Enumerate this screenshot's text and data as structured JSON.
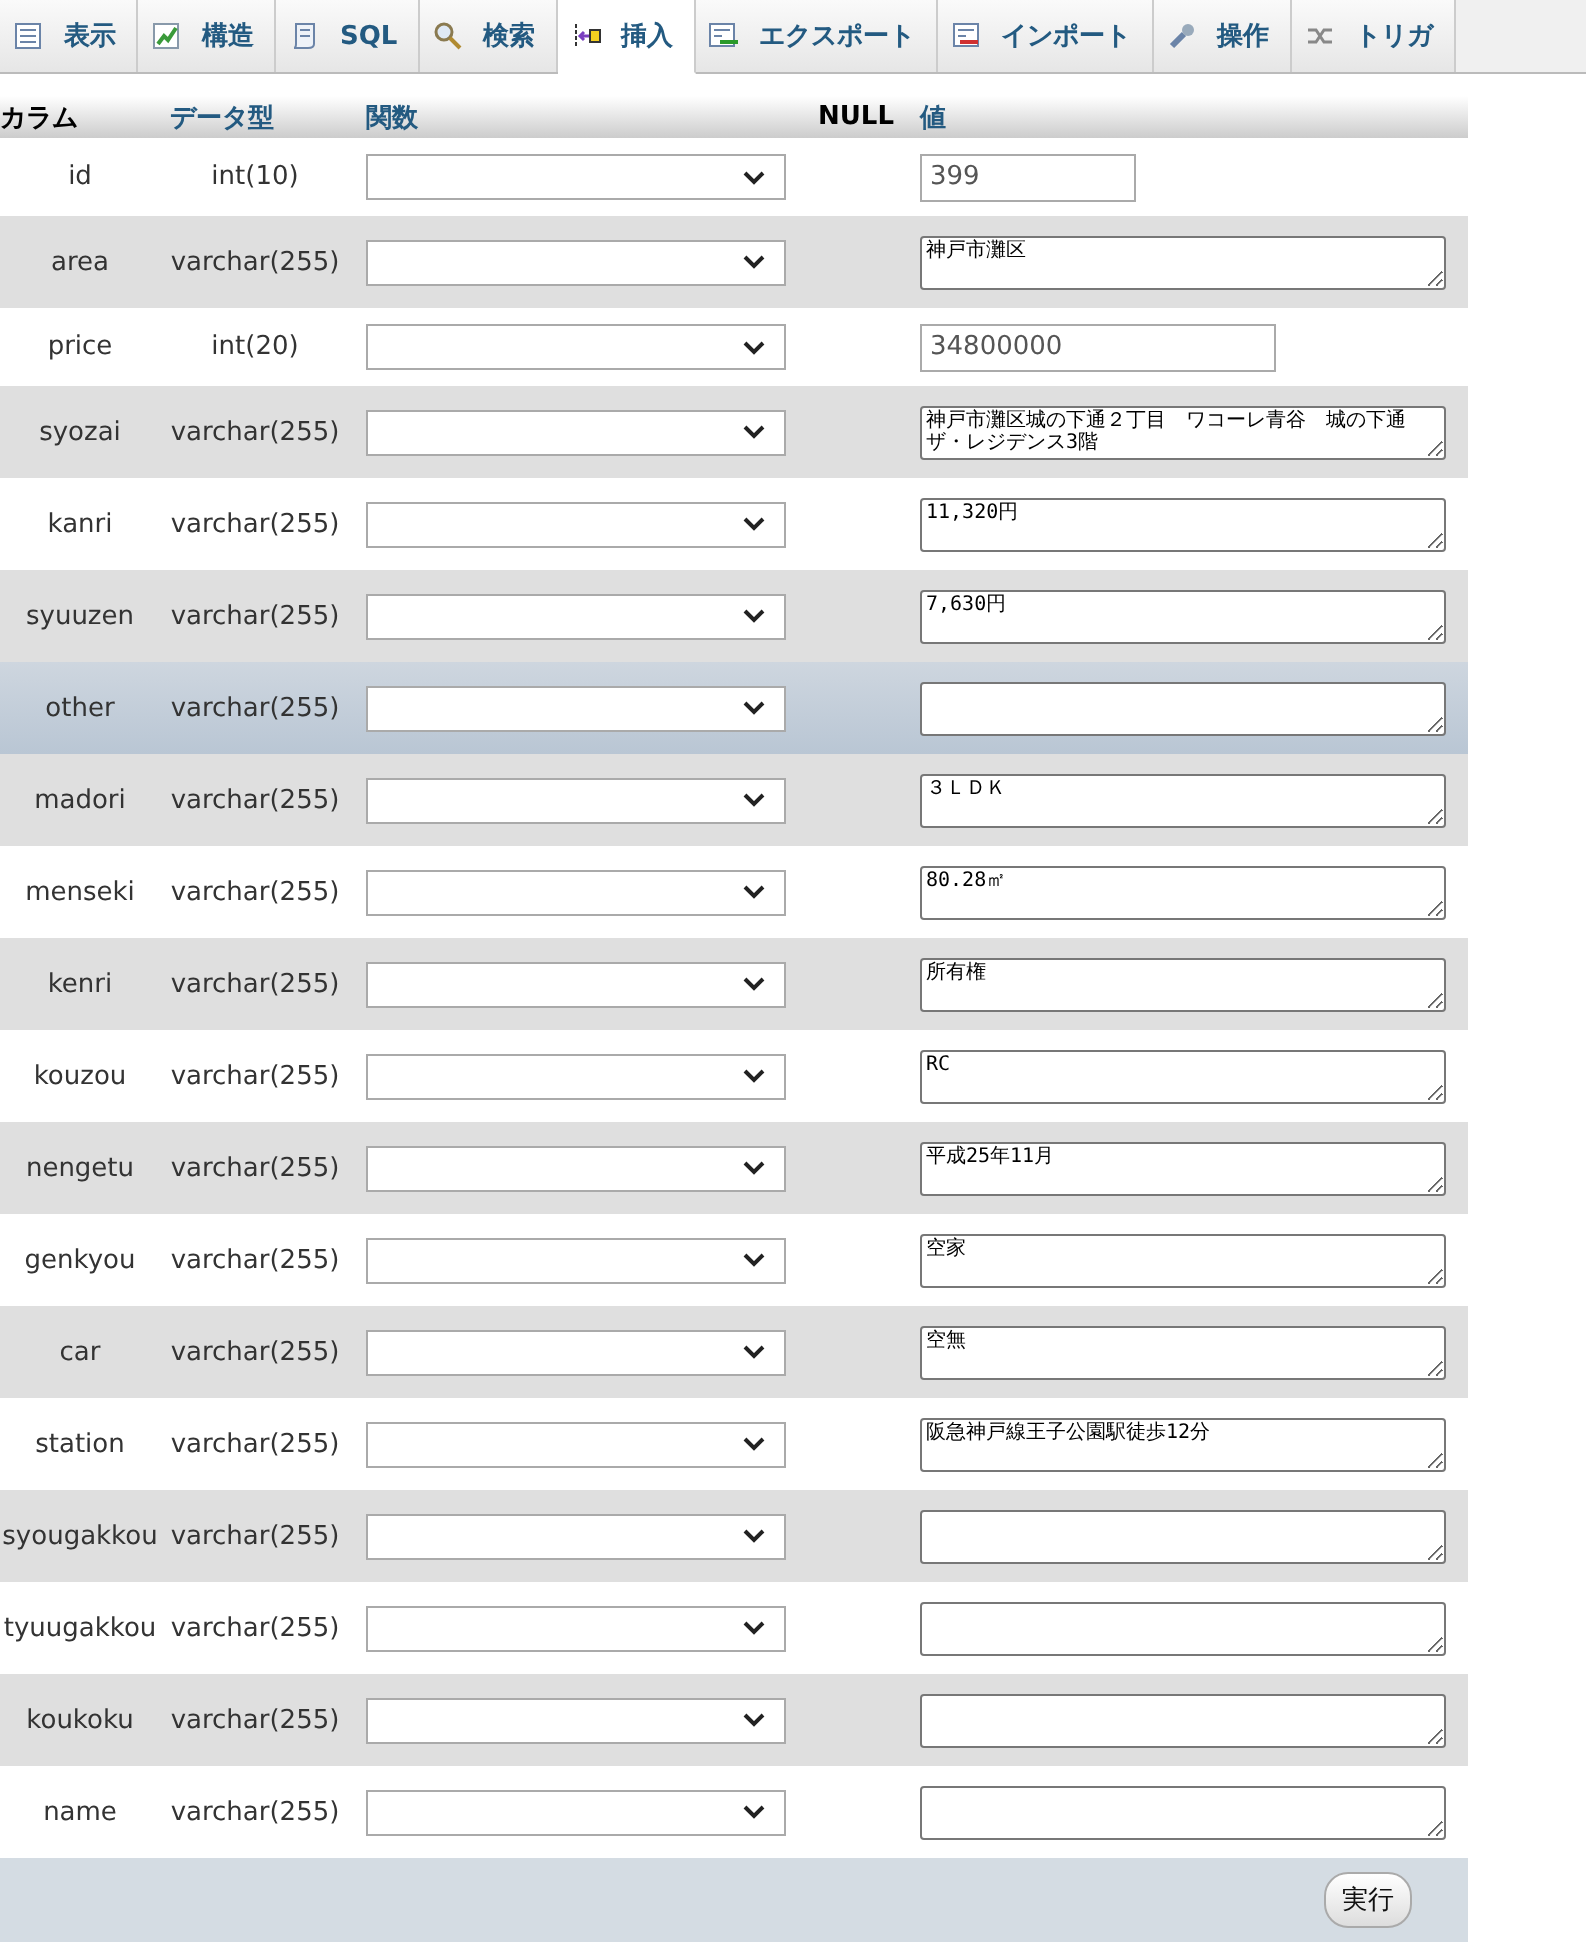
{
  "tabs": [
    {
      "label": "表示",
      "kind": "browse",
      "selected": false
    },
    {
      "label": "構造",
      "kind": "structure",
      "selected": false
    },
    {
      "label": "SQL",
      "kind": "sql",
      "selected": false
    },
    {
      "label": "検索",
      "kind": "search",
      "selected": false
    },
    {
      "label": "挿入",
      "kind": "insert",
      "selected": true
    },
    {
      "label": "エクスポート",
      "kind": "export",
      "selected": false
    },
    {
      "label": "インポート",
      "kind": "import",
      "selected": false
    },
    {
      "label": "操作",
      "kind": "operations",
      "selected": false
    },
    {
      "label": "トリガ",
      "kind": "triggers",
      "selected": false
    }
  ],
  "table": {
    "columns": [
      "カラム",
      "データ型",
      "関数",
      "NULL",
      "値"
    ],
    "rows": [
      {
        "column": "id",
        "type": "int(10)",
        "kind": "input",
        "value": "399",
        "highlighted": false
      },
      {
        "column": "area",
        "type": "varchar(255)",
        "kind": "textarea",
        "value": "神戸市灘区",
        "highlighted": false
      },
      {
        "column": "price",
        "type": "int(20)",
        "kind": "input",
        "value": "34800000",
        "highlighted": false
      },
      {
        "column": "syozai",
        "type": "varchar(255)",
        "kind": "textarea",
        "value": "神戸市灘区城の下通２丁目　ワコーレ青谷　城の下通ザ・レジデンス3階",
        "highlighted": false
      },
      {
        "column": "kanri",
        "type": "varchar(255)",
        "kind": "textarea",
        "value": "11,320円",
        "highlighted": false
      },
      {
        "column": "syuuzen",
        "type": "varchar(255)",
        "kind": "textarea",
        "value": "7,630円",
        "highlighted": false
      },
      {
        "column": "other",
        "type": "varchar(255)",
        "kind": "textarea",
        "value": "",
        "highlighted": true
      },
      {
        "column": "madori",
        "type": "varchar(255)",
        "kind": "textarea",
        "value": "３ＬＤＫ",
        "highlighted": false
      },
      {
        "column": "menseki",
        "type": "varchar(255)",
        "kind": "textarea",
        "value": "80.28㎡",
        "highlighted": false
      },
      {
        "column": "kenri",
        "type": "varchar(255)",
        "kind": "textarea",
        "value": "所有権",
        "highlighted": false
      },
      {
        "column": "kouzou",
        "type": "varchar(255)",
        "kind": "textarea",
        "value": "RC",
        "highlighted": false
      },
      {
        "column": "nengetu",
        "type": "varchar(255)",
        "kind": "textarea",
        "value": "平成25年11月",
        "highlighted": false
      },
      {
        "column": "genkyou",
        "type": "varchar(255)",
        "kind": "textarea",
        "value": "空家",
        "highlighted": false
      },
      {
        "column": "car",
        "type": "varchar(255)",
        "kind": "textarea",
        "value": "空無",
        "highlighted": false
      },
      {
        "column": "station",
        "type": "varchar(255)",
        "kind": "textarea",
        "value": "阪急神戸線王子公園駅徒歩12分",
        "highlighted": false
      },
      {
        "column": "syougakkou",
        "type": "varchar(255)",
        "kind": "textarea",
        "value": "",
        "highlighted": false
      },
      {
        "column": "tyuugakkou",
        "type": "varchar(255)",
        "kind": "textarea",
        "value": "",
        "highlighted": false
      },
      {
        "column": "koukoku",
        "type": "varchar(255)",
        "kind": "textarea",
        "value": "",
        "highlighted": false
      },
      {
        "column": "name",
        "type": "varchar(255)",
        "kind": "textarea",
        "value": "",
        "highlighted": false
      }
    ]
  },
  "submit": "実行"
}
